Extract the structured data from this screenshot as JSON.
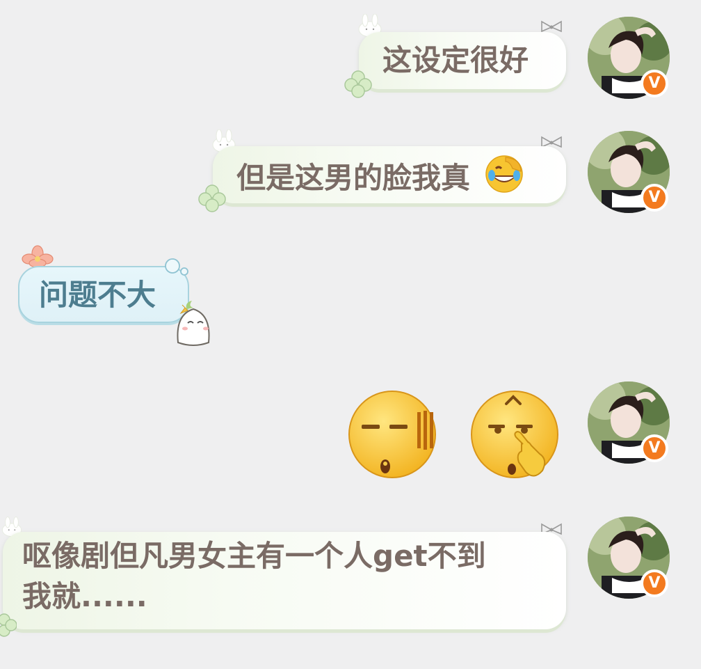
{
  "messages": [
    {
      "side": "right",
      "text": "这设定很好"
    },
    {
      "side": "right",
      "text": "但是这男的脸我真",
      "emoji": "laughing-facepalm-emoji"
    },
    {
      "side": "left",
      "text": "问题不大"
    },
    {
      "side": "right",
      "stickers": [
        "speechless-face-emoji",
        "shush-thinking-face-emoji"
      ]
    },
    {
      "side": "right",
      "text_line1": "呕像剧但凡男女主有一个人get不到",
      "text_line2": "我就......"
    }
  ],
  "avatar": {
    "badge": "V",
    "badge_color": "#f37a1f"
  },
  "colors": {
    "background": "#efeff0",
    "text_right": "#7a6b65",
    "text_left": "#4d7d8f",
    "bubble_right": "#f3f9ee",
    "bubble_left": "#e2f3f9"
  }
}
